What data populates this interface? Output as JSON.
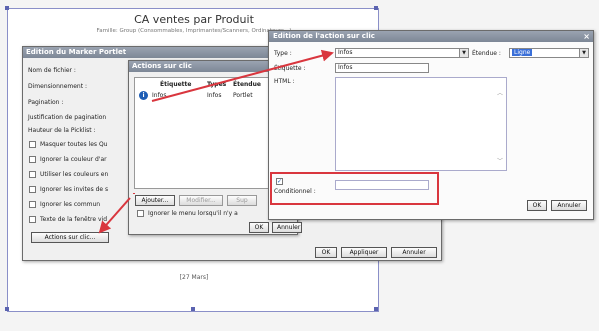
{
  "report": {
    "title": "CA ventes par Produit",
    "subtitle": "Famille: Group (Consommables, Imprimantes/Scanners, Ordinateurs...)",
    "footer": "[27 Mars]"
  },
  "marker_dialog": {
    "title": "Edition du Marker Portlet",
    "labels": {
      "filename": "Nom de fichier :",
      "sizing": "Dimensionnement :",
      "pagination": "Pagination :",
      "justification": "Justification de pagination",
      "picklist_height": "Hauteur de la Picklist :"
    },
    "checkboxes": [
      "Masquer toutes les Qu",
      "Ignorer la couleur d'ar",
      "Utiliser les couleurs en",
      "Ignorer les invites de s",
      "Ignorer les commun",
      "Texte de la fenêtre vid"
    ],
    "actions_button": "Actions sur clic...",
    "ok": "OK",
    "apply": "Appliquer",
    "cancel": "Annuler"
  },
  "actions_dialog": {
    "title": "Actions sur clic",
    "columns": [
      "Étiquette",
      "Types",
      "Étendue"
    ],
    "rows": [
      {
        "label": "Infos",
        "type": "Infos",
        "scope": "Portlet"
      }
    ],
    "info_icon": "info-icon",
    "add_button": "Ajouter...",
    "modify_button": "Modifier...",
    "delete_button": "Sup",
    "ignore_menu_label": "Ignorer le menu lorsqu'il n'y a",
    "ok": "OK",
    "cancel": "Annuler"
  },
  "edition_dialog": {
    "title": "Edition de l'action sur clic",
    "type_label": "Type :",
    "type_value": "Infos",
    "scope_label": "Étendue :",
    "scope_value": "Ligne",
    "etiquette_label": "Étiquette :",
    "etiquette_value": "Infos",
    "html_label": "HTML :",
    "conditional_label": "Conditionnel :",
    "ok": "OK",
    "cancel": "Annuler",
    "close_glyph": "×"
  },
  "colors": {
    "annotation_red": "#d9363e",
    "title_bar": "#8a93a2",
    "selection_blue": "#3a6fd8"
  }
}
